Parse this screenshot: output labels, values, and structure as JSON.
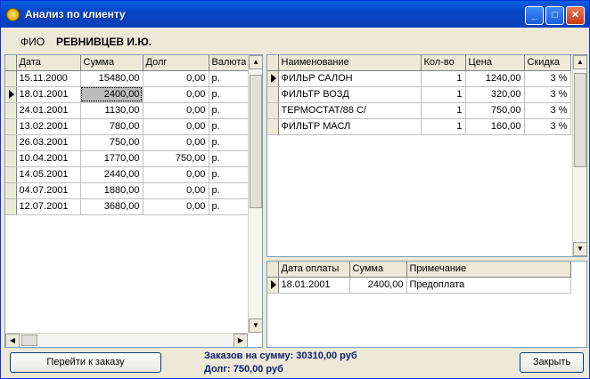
{
  "window": {
    "title": "Анализ по клиенту"
  },
  "client": {
    "fio_label": "ФИО",
    "fio_value": "РЕВНИВЦЕВ И.Ю."
  },
  "orders": {
    "columns": [
      "Дата",
      "Сумма",
      "Долг",
      "Валюта"
    ],
    "rows": [
      [
        "15.11.2000",
        "15480,00",
        "0,00",
        "р."
      ],
      [
        "18.01.2001",
        "2400,00",
        "0,00",
        "р."
      ],
      [
        "24.01.2001",
        "1130,00",
        "0,00",
        "р."
      ],
      [
        "13.02.2001",
        "780,00",
        "0,00",
        "р."
      ],
      [
        "26.03.2001",
        "750,00",
        "0,00",
        "р."
      ],
      [
        "10.04.2001",
        "1770,00",
        "750,00",
        "р."
      ],
      [
        "14.05.2001",
        "2440,00",
        "0,00",
        "р."
      ],
      [
        "04.07.2001",
        "1880,00",
        "0,00",
        "р."
      ],
      [
        "12.07.2001",
        "3680,00",
        "0,00",
        "р."
      ]
    ]
  },
  "items": {
    "columns": [
      "Наименование",
      "Кол-во",
      "Цена",
      "Скидка"
    ],
    "rows": [
      [
        "ФИЛЬР САЛОН",
        "1",
        "1240,00",
        "3 %"
      ],
      [
        "ФИЛЬТР ВОЗД",
        "1",
        "320,00",
        "3 %"
      ],
      [
        "ТЕРМОСТАТ/88 С/",
        "1",
        "750,00",
        "3 %"
      ],
      [
        "ФИЛЬТР МАСЛ",
        "1",
        "160,00",
        "3 %"
      ]
    ]
  },
  "payments": {
    "columns": [
      "Дата оплаты",
      "Сумма",
      "Примечание"
    ],
    "rows": [
      [
        "18.01.2001",
        "2400,00",
        "Предоплата"
      ]
    ]
  },
  "footer": {
    "goto_order_label": "Перейти к заказу",
    "total_line": "Заказов на сумму: 30310,00 руб",
    "debt_line": "Долг: 750,00 руб",
    "close_label": "Закрыть"
  },
  "icons": {
    "minimize": "minimize-icon",
    "maximize": "maximize-icon",
    "close": "close-icon",
    "row_pointer": "row-pointer-icon"
  }
}
